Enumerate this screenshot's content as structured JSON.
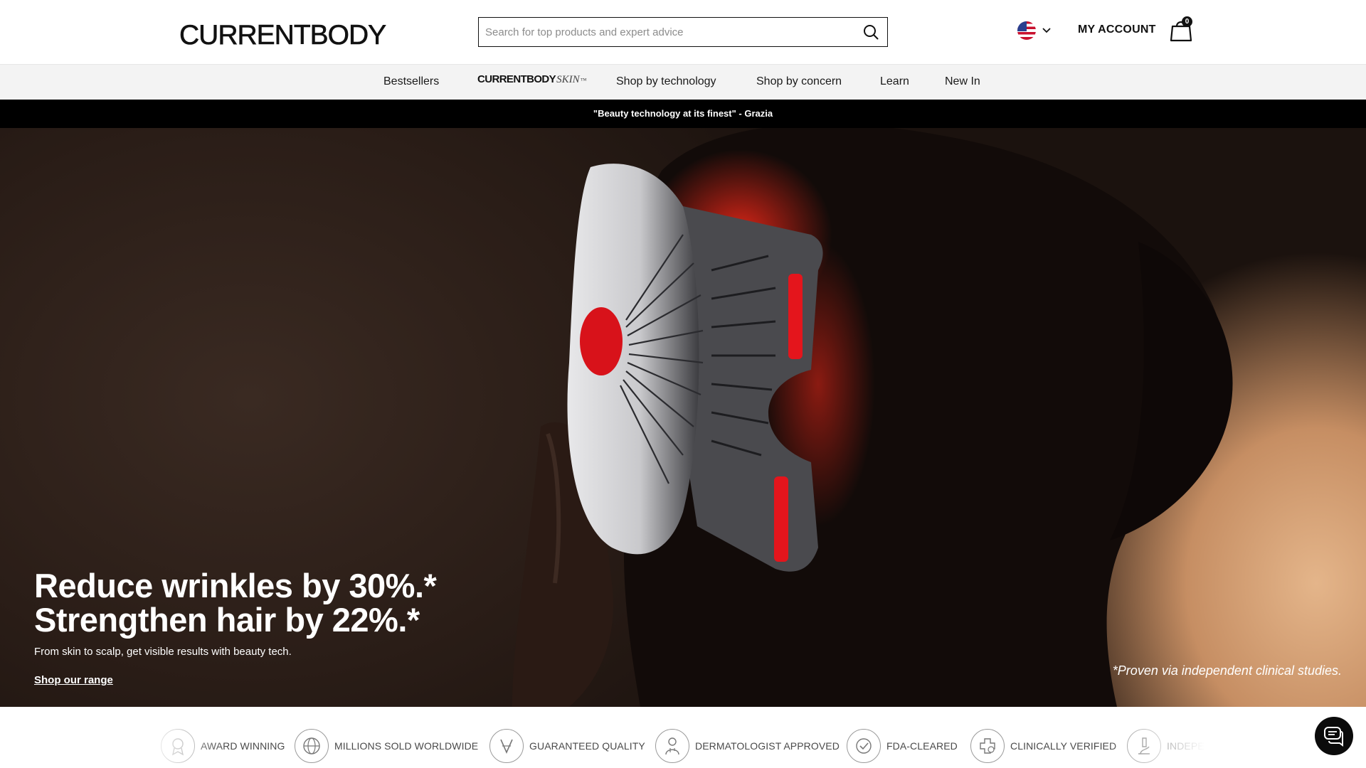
{
  "header": {
    "logo": "CURRENTBODY",
    "search_placeholder": "Search for top products and expert advice",
    "account_label": "MY ACCOUNT",
    "cart_count": "0",
    "flag_icon": "us-flag-icon"
  },
  "nav": {
    "items": [
      "Bestsellers",
      "Shop by technology",
      "Shop by concern",
      "Learn",
      "New In"
    ],
    "skin_brand": "CURRENTBODY",
    "skin_suffix": "SKIN",
    "skin_mark": "™"
  },
  "promo": {
    "text": "\"Beauty technology at its finest\" - Grazia"
  },
  "hero": {
    "headline_1": "Reduce wrinkles by 30%.*",
    "headline_2": "Strengthen hair by 22%.*",
    "subtext": "From skin to scalp, get visible results with beauty tech.",
    "cta": "Shop our range",
    "footnote": "*Proven via independent clinical studies."
  },
  "trust": {
    "items": [
      {
        "label": "AWARD WINNING",
        "icon": "award-icon"
      },
      {
        "label": "MILLIONS SOLD WORLDWIDE",
        "icon": "globe-icon"
      },
      {
        "label": "GUARANTEED QUALITY",
        "icon": "quality-badge-icon"
      },
      {
        "label": "DERMATOLOGIST APPROVED",
        "icon": "dermatologist-icon"
      },
      {
        "label": "FDA-CLEARED",
        "icon": "fda-check-icon"
      },
      {
        "label": "CLINICALLY VERIFIED",
        "icon": "medical-cross-icon"
      },
      {
        "label": "INDEPE",
        "icon": "microscope-icon"
      }
    ]
  },
  "colors": {
    "promo_bg": "#000000",
    "nav_bg": "#f3f3f3",
    "accent_red": "#d4141c"
  }
}
